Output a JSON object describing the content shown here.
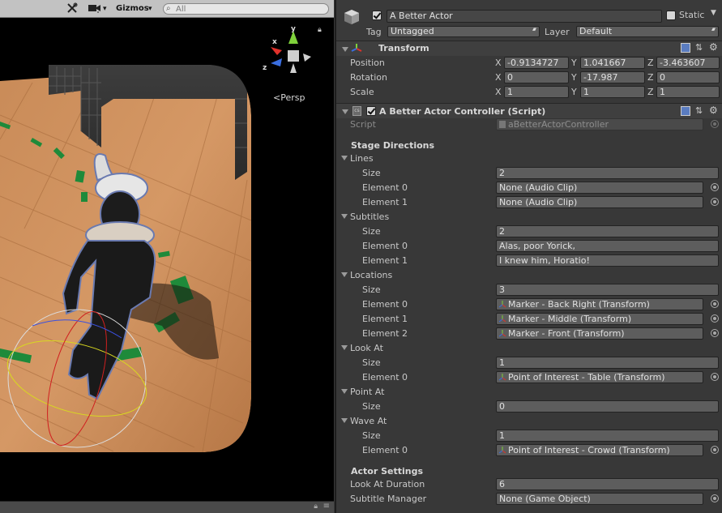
{
  "scene": {
    "gizmos_label": "Gizmos",
    "search_placeholder": "All",
    "persp_label": "Persp",
    "axis_labels": {
      "y": "y",
      "x": "x",
      "z": "z"
    }
  },
  "object": {
    "name": "A Better Actor",
    "static_label": "Static",
    "tag_label": "Tag",
    "tag_value": "Untagged",
    "layer_label": "Layer",
    "layer_value": "Default"
  },
  "transform": {
    "title": "Transform",
    "rows": [
      {
        "label": "Position",
        "x": "-0.9134727",
        "y": "1.041667",
        "z": "-3.463607"
      },
      {
        "label": "Rotation",
        "x": "0",
        "y": "-17.987",
        "z": "0"
      },
      {
        "label": "Scale",
        "x": "1",
        "y": "1",
        "z": "1"
      }
    ],
    "axis": {
      "x": "X",
      "y": "Y",
      "z": "Z"
    }
  },
  "controller": {
    "title": "A Better Actor Controller (Script)",
    "script_label": "Script",
    "script_value": "aBetterActorController",
    "stage_directions": "Stage Directions",
    "lines": {
      "label": "Lines",
      "size_label": "Size",
      "size": "2",
      "elements": [
        {
          "label": "Element 0",
          "value": "None (Audio Clip)"
        },
        {
          "label": "Element 1",
          "value": "None (Audio Clip)"
        }
      ]
    },
    "subtitles": {
      "label": "Subtitles",
      "size_label": "Size",
      "size": "2",
      "elements": [
        {
          "label": "Element 0",
          "value": "Alas, poor Yorick,"
        },
        {
          "label": "Element 1",
          "value": "I knew him, Horatio!"
        }
      ]
    },
    "locations": {
      "label": "Locations",
      "size_label": "Size",
      "size": "3",
      "elements": [
        {
          "label": "Element 0",
          "value": "Marker - Back Right (Transform)"
        },
        {
          "label": "Element 1",
          "value": "Marker - Middle (Transform)"
        },
        {
          "label": "Element 2",
          "value": "Marker - Front (Transform)"
        }
      ]
    },
    "look_at": {
      "label": "Look At",
      "size_label": "Size",
      "size": "1",
      "elements": [
        {
          "label": "Element 0",
          "value": "Point of Interest - Table (Transform)"
        }
      ]
    },
    "point_at": {
      "label": "Point At",
      "size_label": "Size",
      "size": "0"
    },
    "wave_at": {
      "label": "Wave At",
      "size_label": "Size",
      "size": "1",
      "elements": [
        {
          "label": "Element 0",
          "value": "Point of Interest - Crowd (Transform)"
        }
      ]
    },
    "actor_settings": "Actor Settings",
    "look_at_duration_label": "Look At Duration",
    "look_at_duration": "6",
    "subtitle_manager_label": "Subtitle Manager",
    "subtitle_manager": "None (Game Object)"
  },
  "colors": {
    "background": "#383838",
    "field": "#5d5d5d",
    "gizmo_y": "#7fd13b",
    "gizmo_x": "#e0312b",
    "gizmo_z": "#3a6ee0",
    "floor": "#c88a55"
  }
}
